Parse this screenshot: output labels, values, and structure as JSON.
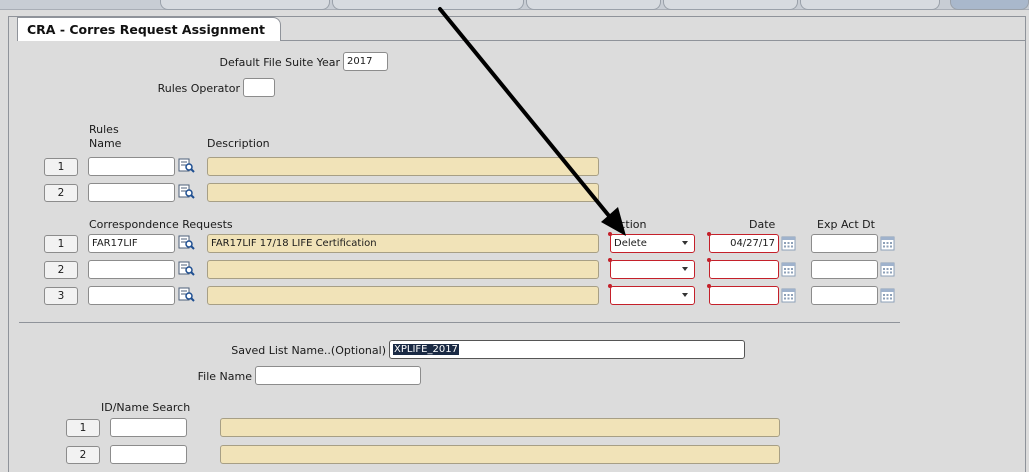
{
  "tab": {
    "title": "CRA - Corres Request Assignment"
  },
  "header": {
    "file_suite_year_label": "Default File Suite Year",
    "file_suite_year_value": "2017",
    "rules_operator_label": "Rules Operator",
    "rules_operator_value": ""
  },
  "rules": {
    "header_line1": "Rules",
    "header_line2": "Name",
    "description_header": "Description",
    "rows": [
      {
        "num": "1",
        "name": "",
        "description": ""
      },
      {
        "num": "2",
        "name": "",
        "description": ""
      }
    ]
  },
  "corr": {
    "header": "Correspondence Requests",
    "action_header": "Action",
    "date_header": "Date",
    "exp_header": "Exp Act Dt",
    "rows": [
      {
        "num": "1",
        "name": "FAR17LIF",
        "description": "FAR17LIF 17/18 LIFE Certification",
        "action": "Delete",
        "date": "04/27/17",
        "exp": ""
      },
      {
        "num": "2",
        "name": "",
        "description": "",
        "action": "",
        "date": "",
        "exp": ""
      },
      {
        "num": "3",
        "name": "",
        "description": "",
        "action": "",
        "date": "",
        "exp": ""
      }
    ]
  },
  "saved": {
    "list_label": "Saved List Name..(Optional)",
    "list_value": "XPLIFE_2017",
    "file_label": "File Name",
    "file_value": ""
  },
  "idsearch": {
    "header": "ID/Name Search",
    "rows": [
      {
        "num": "1",
        "id": "",
        "name": ""
      },
      {
        "num": "2",
        "id": "",
        "name": ""
      }
    ]
  },
  "icons": {
    "lookup": "magnifier-list-icon",
    "calendar": "calendar-icon",
    "dropdown": "chevron-down-icon"
  }
}
